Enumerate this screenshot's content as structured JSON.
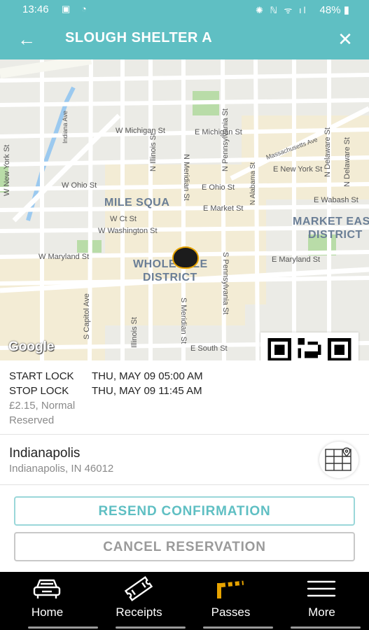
{
  "status": {
    "time": "13:46",
    "left_icons": "▣ ◔",
    "right_icons": "✺ ℕ ᯤ ıl",
    "battery": "48% ▮"
  },
  "header": {
    "back_icon": "arrow-left-icon",
    "title": "SLOUGH SHELTER A",
    "close_icon": "close-icon"
  },
  "map": {
    "street_labels": [
      "W Michigan St",
      "E Michigan St",
      "W Ohio St",
      "E Ohio St",
      "E New York St",
      "E Wabash St",
      "W Ct St",
      "E Market St",
      "W Washington St",
      "W Maryland St",
      "E Maryland St",
      "E South St",
      "W New York St",
      "Indiana Ave",
      "S Capitol Ave",
      "Illinois St",
      "S Meridian St",
      "S Pennsylvania St",
      "N Meridian St",
      "N Illinois St",
      "N Pennsylvania St",
      "Massachusetts Ave",
      "N Delaware St",
      "N Alabama St",
      "N Delaware St"
    ],
    "district_labels": [
      "MILE SQUA",
      "WHOLESALE",
      "DISTRICT",
      "MARKET EAS",
      "DISTRICT"
    ],
    "attribution": "Google",
    "colors": {
      "land": "#ebebe6",
      "road": "#ffffff",
      "park": "#b9dca8",
      "water": "#9bc9ef",
      "district": "#f3ecd5"
    }
  },
  "reservation": {
    "start_label": "START LOCK",
    "start_value": "THU, MAY 09 05:00 AM",
    "stop_label": "STOP LOCK",
    "stop_value": "THU, MAY 09 11:45 AM",
    "price": "£2.15, Normal",
    "status": "Reserved"
  },
  "location": {
    "name": "Indianapolis",
    "address": "Indianapolis, IN 46012",
    "map_icon": "map-pin-icon"
  },
  "actions": {
    "resend": "RESEND CONFIRMATION",
    "cancel": "CANCEL RESERVATION"
  },
  "nav": {
    "items": [
      {
        "label": "Home",
        "icon": "car-icon"
      },
      {
        "label": "Receipts",
        "icon": "ticket-icon"
      },
      {
        "label": "Passes",
        "icon": "barrier-icon"
      },
      {
        "label": "More",
        "icon": "menu-icon"
      }
    ]
  },
  "theme": {
    "accent": "#5fbfc3",
    "pin_border": "#e7a300",
    "nav_bg": "#000000"
  }
}
